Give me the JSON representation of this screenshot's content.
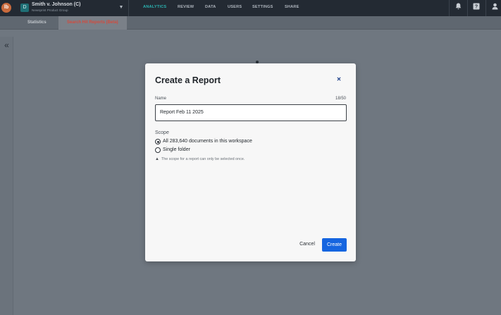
{
  "app": {
    "logo_text": "lb"
  },
  "workspace": {
    "badge": "D",
    "name": "Smith v. Johnson (C)",
    "subtitle": "Newsprint Product Group",
    "caret_icon": "caret-down-icon"
  },
  "nav": {
    "items": [
      {
        "label": "ANALYTICS",
        "active": true
      },
      {
        "label": "REVIEW",
        "active": false
      },
      {
        "label": "DATA",
        "active": false
      },
      {
        "label": "USERS",
        "active": false
      },
      {
        "label": "SETTINGS",
        "active": false
      },
      {
        "label": "SHARE",
        "active": false
      }
    ],
    "right_icons": [
      "bell-icon",
      "help-icon",
      "user-icon"
    ]
  },
  "subtabs": [
    {
      "label": "Statistics",
      "active": false
    },
    {
      "label": "Search Hit Reports (Beta)",
      "active": true
    }
  ],
  "modal": {
    "title": "Create a Report",
    "close_icon": "close-icon",
    "name_label": "Name",
    "char_count": "18/50",
    "name_value": "Report Feb 11 2025",
    "scope_label": "Scope",
    "scope_options": [
      {
        "label": "All 283,640 documents in this workspace",
        "selected": true
      },
      {
        "label": "Single folder",
        "selected": false
      }
    ],
    "warning": "The scope for a report can only be selected once.",
    "warning_icon": "warning-icon",
    "cancel_label": "Cancel",
    "create_label": "Create"
  },
  "colors": {
    "accent": "#2bb3b1",
    "active_tab": "#d44a3d",
    "primary_button": "#1565e0",
    "overlay": "#6f7780"
  }
}
